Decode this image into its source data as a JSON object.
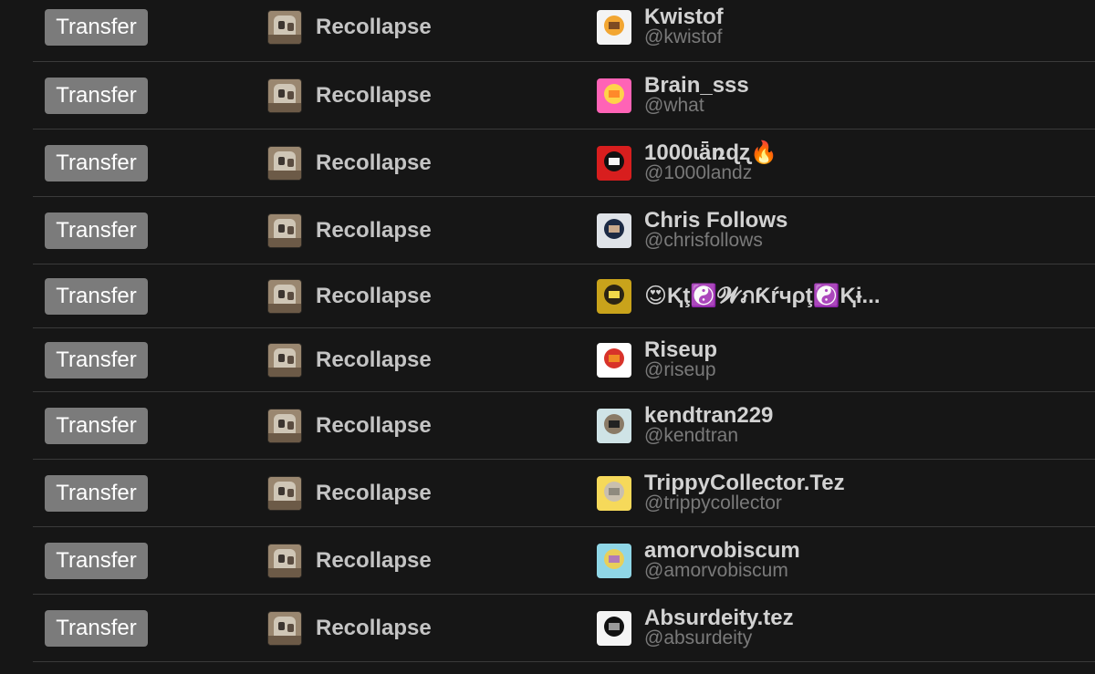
{
  "rows": [
    {
      "action": "Transfer",
      "collection": "Recollapse",
      "name": "Kwistof",
      "handle": "@kwistof",
      "avatar_colors": [
        "#f4f4f4",
        "#f2a632",
        "#7c4a22"
      ]
    },
    {
      "action": "Transfer",
      "collection": "Recollapse",
      "name": "Brain_sss",
      "handle": "@what",
      "avatar_colors": [
        "#ff63b6",
        "#ffd34a",
        "#ff8a2a"
      ]
    },
    {
      "action": "Transfer",
      "collection": "Recollapse",
      "name": "1000ɩǟռɖʐ🔥",
      "handle": "@1000landz",
      "avatar_colors": [
        "#d81e1e",
        "#111111",
        "#f5f5f5"
      ]
    },
    {
      "action": "Transfer",
      "collection": "Recollapse",
      "name": "Chris Follows",
      "handle": "@chrisfollows",
      "avatar_colors": [
        "#dfe3e8",
        "#1c2a44",
        "#c9a98c"
      ]
    },
    {
      "action": "Transfer",
      "collection": "Recollapse",
      "name": "😍Ⱪţ☯️𝓦ภƘŕчρţ☯️Ⱪɨ...",
      "handle": "",
      "avatar_colors": [
        "#c9a31b",
        "#2b2414",
        "#f1d84a"
      ]
    },
    {
      "action": "Transfer",
      "collection": "Recollapse",
      "name": "Riseup",
      "handle": "@riseup",
      "avatar_colors": [
        "#ffffff",
        "#d8332a",
        "#f08a24"
      ]
    },
    {
      "action": "Transfer",
      "collection": "Recollapse",
      "name": "kendtran229",
      "handle": "@kendtran",
      "avatar_colors": [
        "#cfe3e6",
        "#8a7a66",
        "#222222"
      ]
    },
    {
      "action": "Transfer",
      "collection": "Recollapse",
      "name": "TrippyCollector.Tez",
      "handle": "@trippycollector",
      "avatar_colors": [
        "#f6d95a",
        "#c9bfae",
        "#8f8a7e"
      ]
    },
    {
      "action": "Transfer",
      "collection": "Recollapse",
      "name": "amorvobiscum",
      "handle": "@amorvobiscum",
      "avatar_colors": [
        "#8fd6e6",
        "#e8cf5a",
        "#b07ab8"
      ]
    },
    {
      "action": "Transfer",
      "collection": "Recollapse",
      "name": "Absurdeity.tez",
      "handle": "@absurdeity",
      "avatar_colors": [
        "#f4f4f4",
        "#111111",
        "#9a9a9a"
      ]
    }
  ]
}
